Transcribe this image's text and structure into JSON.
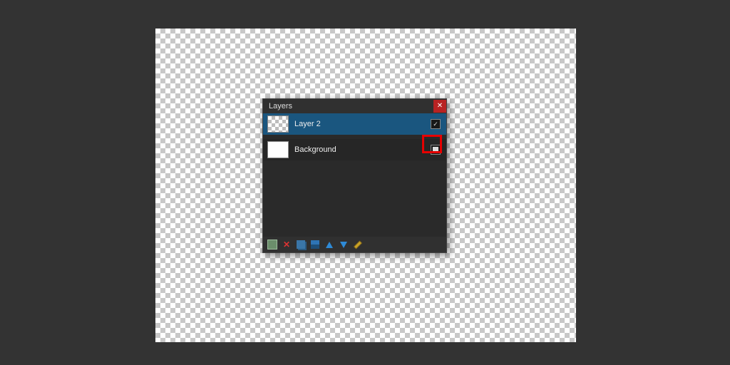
{
  "panel": {
    "title": "Layers"
  },
  "layers": [
    {
      "name": "Layer 2",
      "selected": true,
      "visible": true,
      "thumb": "checker"
    },
    {
      "name": "Background",
      "selected": false,
      "visible": false,
      "thumb": "white"
    }
  ],
  "toolbar": {
    "tips": {
      "add": "Add New Layer",
      "del": "Delete Layer",
      "dup": "Duplicate Layer",
      "merge": "Merge Layer Down",
      "up": "Move Layer Up",
      "down": "Move Layer Down",
      "prop": "Properties"
    }
  },
  "colors": {
    "accent": "#1a567f",
    "danger": "#b82323",
    "highlight": "#e60000"
  }
}
